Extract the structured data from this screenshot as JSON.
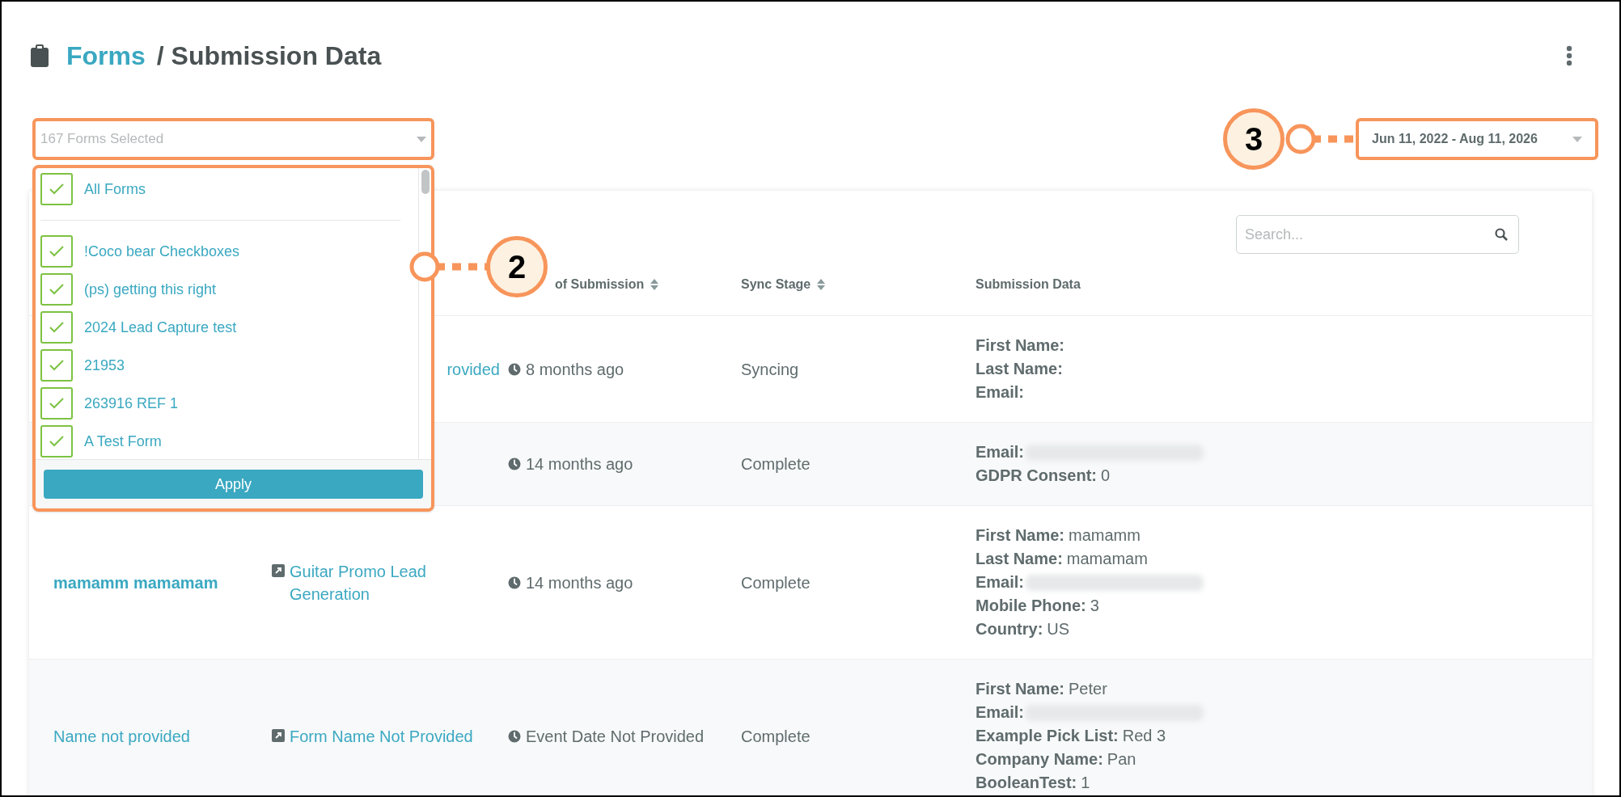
{
  "header": {
    "breadcrumb_link": "Forms",
    "title": "/ Submission Data"
  },
  "form_filter": {
    "placeholder": "167 Forms Selected",
    "expanded": true,
    "all_option": {
      "label": "All Forms",
      "checked": true
    },
    "options": [
      {
        "label": "!Coco bear Checkboxes",
        "checked": true
      },
      {
        "label": "(ps) getting this right",
        "checked": true
      },
      {
        "label": "2024 Lead Capture test",
        "checked": true
      },
      {
        "label": "21953",
        "checked": true
      },
      {
        "label": "263916 REF 1",
        "checked": true
      },
      {
        "label": "A Test Form",
        "checked": true
      }
    ],
    "apply_button": "Apply"
  },
  "date_range": {
    "value": "Jun 11, 2022 - Aug 11, 2026"
  },
  "callouts": [
    {
      "number": "2"
    },
    {
      "number": "3"
    }
  ],
  "search": {
    "placeholder": "Search..."
  },
  "table": {
    "columns": [
      {
        "label": "of Submission",
        "sortable": true
      },
      {
        "label": "Sync Stage",
        "sortable": true
      },
      {
        "label": "Submission Data",
        "sortable": false
      }
    ],
    "rows": [
      {
        "form": "rovided",
        "time": "8 months ago",
        "stage": "Syncing",
        "data": [
          {
            "label": "First Name:"
          },
          {
            "label": "Last Name:"
          },
          {
            "label": "Email:"
          }
        ]
      },
      {
        "time": "14 months ago",
        "stage": "Complete",
        "data": [
          {
            "label": "Email:",
            "redacted": true
          },
          {
            "label": "GDPR Consent:",
            "value": "0"
          }
        ]
      },
      {
        "name": "mamamm mamamam",
        "name_bold": true,
        "form": "Guitar Promo Lead Generation",
        "form_icon": true,
        "time": "14 months ago",
        "stage": "Complete",
        "data": [
          {
            "label": "First Name:",
            "value": "mamamm"
          },
          {
            "label": "Last Name:",
            "value": "mamamam"
          },
          {
            "label": "Email:",
            "redacted": true
          },
          {
            "label": "Mobile Phone:",
            "value": "3"
          },
          {
            "label": "Country:",
            "value": "US"
          }
        ]
      },
      {
        "name": "Name not provided",
        "name_bold": false,
        "form": "Form Name Not Provided",
        "form_icon": true,
        "time": "Event Date Not Provided",
        "stage": "Complete",
        "data": [
          {
            "label": "First Name:",
            "value": "Peter"
          },
          {
            "label": "Email:",
            "redacted": true
          },
          {
            "label": "Example Pick List:",
            "value": "Red 3"
          },
          {
            "label": "Company Name:",
            "value": "Pan"
          },
          {
            "label": "BooleanTest:",
            "value": "1"
          }
        ]
      }
    ]
  }
}
